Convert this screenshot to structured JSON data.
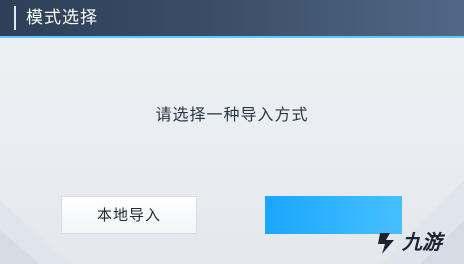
{
  "dialog": {
    "title": "模式选择",
    "prompt": "请选择一种导入方式"
  },
  "buttons": {
    "local_import": "本地导入",
    "second_option": ""
  },
  "watermark": {
    "text": "九游"
  },
  "colors": {
    "header_dark": "#2e3f57",
    "header_accent_line": "#5fc4ff",
    "primary_button": "#1aa6ff",
    "body_bg": "#e9edf1"
  }
}
